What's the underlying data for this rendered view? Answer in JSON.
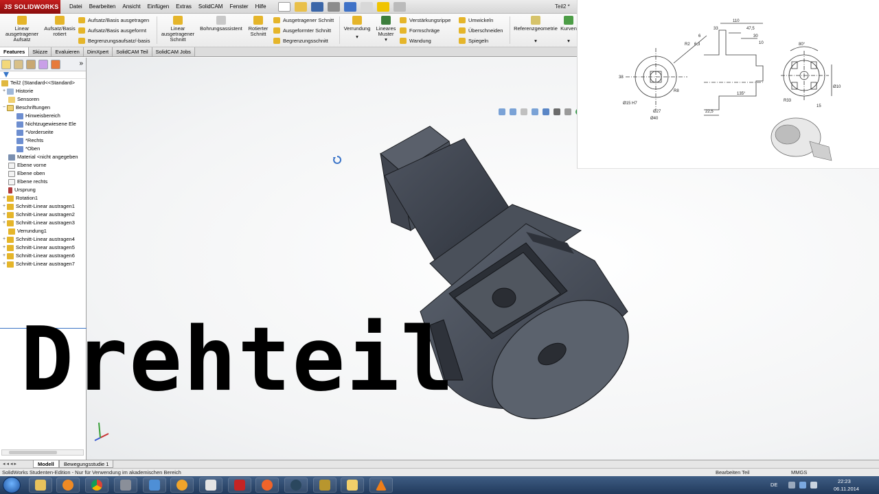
{
  "app": {
    "brand": "SOLIDWORKS",
    "brand_prefix": "3S",
    "document_title": "Teil2 *"
  },
  "menu": [
    "Datei",
    "Bearbeiten",
    "Ansicht",
    "Einfügen",
    "Extras",
    "SolidCAM",
    "Fenster",
    "Hilfe"
  ],
  "ribbon": {
    "linear_boss": "Linear ausgetragener Aufsatz",
    "revolved_boss": "Aufsatz/Basis rotiert",
    "swept_boss": "Aufsatz/Basis ausgetragen",
    "lofted_boss": "Aufsatz/Basis ausgeformt",
    "boundary_boss": "Begrenzungsaufsatz/-basis",
    "linear_cut": "Linear ausgetragener Schnitt",
    "hole_wizard": "Bohrungsassistent",
    "revolved_cut": "Rotierter Schnitt",
    "swept_cut": "Ausgetragener Schnitt",
    "lofted_cut": "Ausgeformter Schnitt",
    "boundary_cut": "Begrenzungsschnitt",
    "fillet": "Verrundung",
    "linear_pattern": "Lineares Muster",
    "rib": "Verstärkungsrippe",
    "draft": "Formschräge",
    "shell": "Wandung",
    "wrap": "Umwickeln",
    "intersect": "Überschneiden",
    "mirror": "Spiegeln",
    "ref_geometry": "Referenzgeometrie",
    "curves": "Kurven"
  },
  "tabs": [
    "Features",
    "Skizze",
    "Evaluieren",
    "DimXpert",
    "SolidCAM Teil",
    "SolidCAM Jobs"
  ],
  "tree": {
    "root": "Teil2 (Standard<<Standard>",
    "items": [
      {
        "label": "Historie",
        "level": 0
      },
      {
        "label": "Sensoren",
        "level": 0
      },
      {
        "label": "Beschriftungen",
        "level": 0
      },
      {
        "label": "Hinweisbereich",
        "level": 1
      },
      {
        "label": "Nichtzugewiesene Ele",
        "level": 1
      },
      {
        "label": "*Vorderseite",
        "level": 1
      },
      {
        "label": "*Rechts",
        "level": 1
      },
      {
        "label": "*Oben",
        "level": 1
      },
      {
        "label": "Material <nicht angegeben",
        "level": 0
      },
      {
        "label": "Ebene vorne",
        "level": 0
      },
      {
        "label": "Ebene oben",
        "level": 0
      },
      {
        "label": "Ebene rechts",
        "level": 0
      },
      {
        "label": "Ursprung",
        "level": 0
      },
      {
        "label": "Rotation1",
        "level": 0
      },
      {
        "label": "Schnitt-Linear austragen1",
        "level": 0
      },
      {
        "label": "Schnitt-Linear austragen2",
        "level": 0
      },
      {
        "label": "Schnitt-Linear austragen3",
        "level": 0
      },
      {
        "label": "Verrundung1",
        "level": 0
      },
      {
        "label": "Schnitt-Linear austragen4",
        "level": 0
      },
      {
        "label": "Schnitt-Linear austragen5",
        "level": 0
      },
      {
        "label": "Schnitt-Linear austragen6",
        "level": 0
      },
      {
        "label": "Schnitt-Linear austragen7",
        "level": 0
      }
    ]
  },
  "overlay_title": "Drehteil",
  "drawing": {
    "dims": [
      "110",
      "33",
      "47,5",
      "30",
      "10",
      "6",
      "R2",
      "6,3",
      "38",
      "Ø15 H7",
      "Ø27",
      "Ø40",
      "22,5",
      "135°",
      "R8",
      "80°",
      "Ø10",
      "R33",
      "15"
    ]
  },
  "bottom_tabs": [
    "Modell",
    "Bewegungsstudie 1"
  ],
  "status": {
    "left": "SolidWorks Studenten-Edition - Nur für Verwendung im akademischen Bereich",
    "mode": "Bearbeiten Teil",
    "units": "MMGS"
  },
  "taskbar": {
    "lang": "DE",
    "time": "22:23",
    "date": "06.11.2014"
  }
}
